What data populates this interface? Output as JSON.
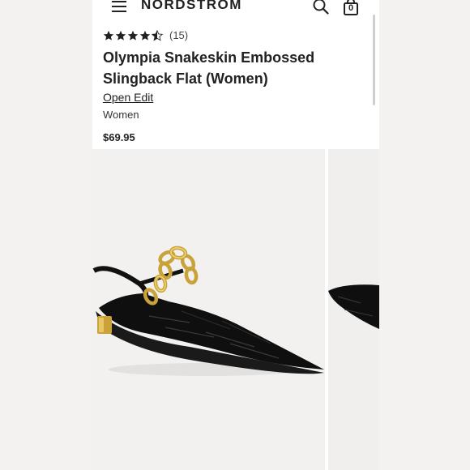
{
  "header": {
    "logo_text": "NORDSTROM",
    "menu_icon": "hamburger-menu-icon",
    "search_icon": "search-icon",
    "bag_icon": "shopping-bag-icon",
    "bag_count": "0"
  },
  "product": {
    "rating": 4.5,
    "review_count": "(15)",
    "title": "Olympia Snakeskin Embossed Slingback Flat (Women)",
    "brand": "Open Edit",
    "category": "Women",
    "price": "$69.95"
  },
  "gallery": {
    "image_count_visible": 2,
    "main_image": "black croc-embossed pointed-toe slingback flat with gold chain strap",
    "next_image": "partial view of black pointed-toe flat"
  },
  "colors": {
    "background": "#ffffff",
    "text": "#222222",
    "image_bg": "#f2f1f0"
  }
}
